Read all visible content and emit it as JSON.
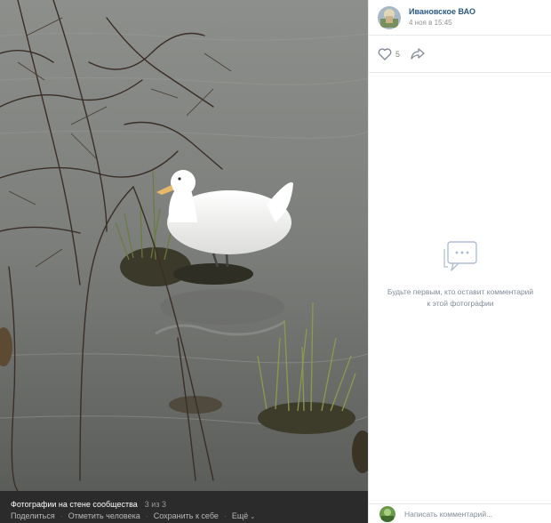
{
  "photo": {
    "alt_icon": "photo",
    "album_label": "Фотографии на стене сообщества",
    "counter": "3 из 3",
    "actions": {
      "share": "Поделиться",
      "tag": "Отметить человека",
      "save": "Сохранить к себе",
      "more": "Ещё"
    }
  },
  "author": {
    "name": "Ивановское ВАО",
    "date": "4 ноя в 15:45"
  },
  "stats": {
    "likes": "5"
  },
  "comments": {
    "empty_icon": "comments-icon",
    "empty_text": "Будьте первым, кто оставит комментарий к этой фотографии"
  },
  "composer": {
    "placeholder": "Написать комментарий..."
  },
  "colors": {
    "link": "#2a5885",
    "muted": "#818c99",
    "bar": "#2b2b2b"
  }
}
